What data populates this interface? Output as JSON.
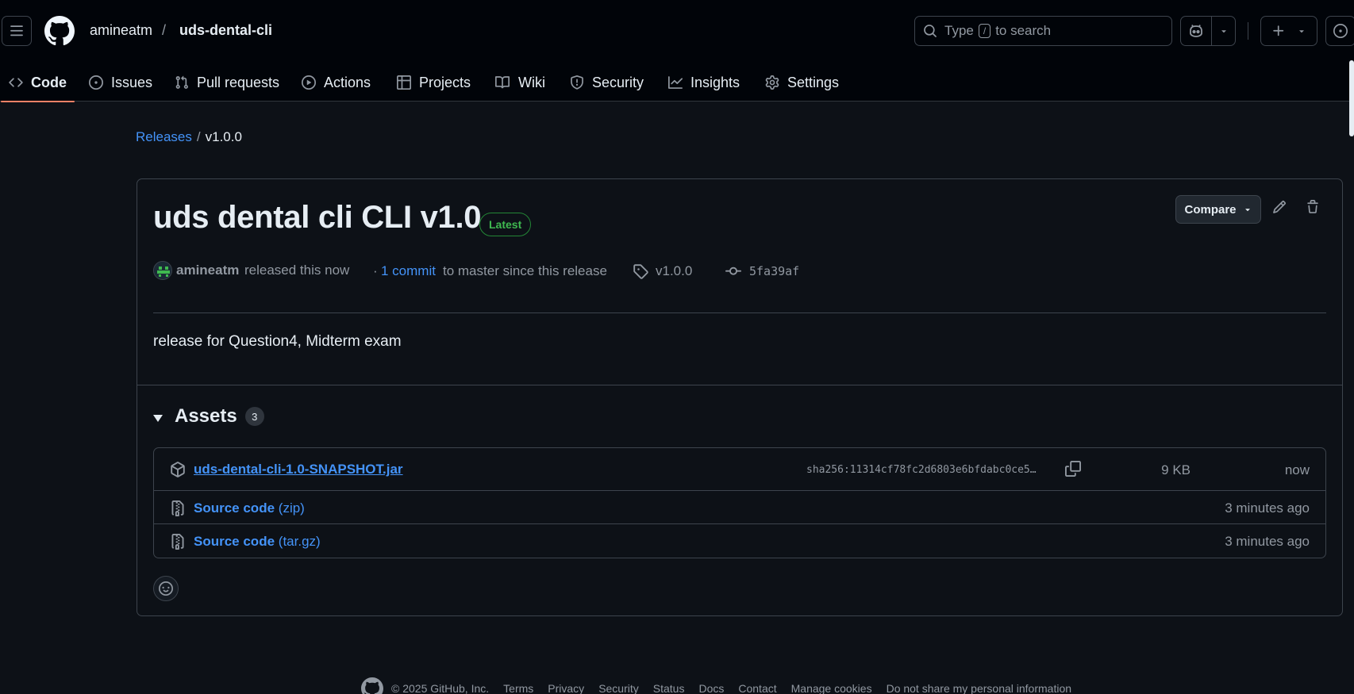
{
  "header": {
    "owner": "amineatm",
    "separator": "/",
    "repo": "uds-dental-cli",
    "search": {
      "prefix": "Type",
      "key": "/",
      "suffix": "to search"
    }
  },
  "tabs": [
    {
      "label": "Code",
      "icon": "code-icon",
      "active": true
    },
    {
      "label": "Issues",
      "icon": "issue-opened-icon"
    },
    {
      "label": "Pull requests",
      "icon": "git-pull-request-icon"
    },
    {
      "label": "Actions",
      "icon": "play-icon"
    },
    {
      "label": "Projects",
      "icon": "table-icon"
    },
    {
      "label": "Wiki",
      "icon": "book-icon"
    },
    {
      "label": "Security",
      "icon": "shield-icon"
    },
    {
      "label": "Insights",
      "icon": "graph-icon"
    },
    {
      "label": "Settings",
      "icon": "gear-icon"
    }
  ],
  "breadcrumb": {
    "parent": "Releases",
    "separator": "/",
    "current": "v1.0.0"
  },
  "release": {
    "title": "uds dental cli CLI v1.0",
    "badge": "Latest",
    "compare_label": "Compare",
    "author": "amineatm",
    "released_text": "released this now",
    "dot": "·",
    "commits_link": "1 commit",
    "commits_rest": "to master since this release",
    "tag": "v1.0.0",
    "sha": "5fa39af",
    "body": "release for Question4, Midterm exam"
  },
  "assets": {
    "title": "Assets",
    "count": "3",
    "items": [
      {
        "name": "uds-dental-cli-1.0-SNAPSHOT.jar",
        "format": "",
        "sha": "sha256:11314cf78fc2d6803e6bfdabc0ce5…",
        "size": "9 KB",
        "time": "now",
        "icon": "package-icon"
      },
      {
        "name": "Source code",
        "format": "(zip)",
        "time": "3 minutes ago",
        "icon": "file-zip-icon"
      },
      {
        "name": "Source code",
        "format": "(tar.gz)",
        "time": "3 minutes ago",
        "icon": "file-zip-icon"
      }
    ]
  },
  "footer": {
    "copyright": "© 2025 GitHub, Inc.",
    "links": [
      "Terms",
      "Privacy",
      "Security",
      "Status",
      "Docs",
      "Contact",
      "Manage cookies",
      "Do not share my personal information"
    ]
  },
  "colors": {
    "accent_link": "#4493f8",
    "latest_green": "#3fb950",
    "tab_underline": "#f78166",
    "bg": "#0d1117",
    "header_bg": "#010409"
  }
}
